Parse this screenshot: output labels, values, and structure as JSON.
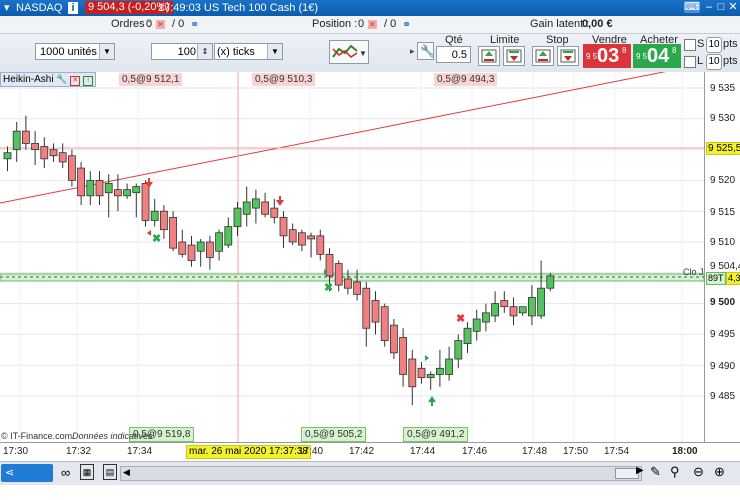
{
  "titlebar": {
    "instrument": "NASDAQ",
    "info_icon": "i",
    "price_change": "9 504,3 (-0,20%)",
    "time_title": "17:49:03 US Tech 100 Cash (1€)"
  },
  "status": {
    "orders_label": "Ordres :",
    "orders_value": "0",
    "orders_sep": "/ 0",
    "position_label": "Position :",
    "position_value": "0",
    "position_sep": "/ 0",
    "gain_label": "Gain latent :",
    "gain_value": "0,00 €"
  },
  "toolbar": {
    "units_value": "1000 unités",
    "ticks_value": "100",
    "ticks_unit": "(x) ticks",
    "qty_label": "Qté",
    "qty_value": "0.5",
    "limit_label": "Limite",
    "stop_label": "Stop",
    "sell_label": "Vendre",
    "buy_label": "Acheter",
    "sell_prefix": "9 5",
    "sell_big": "03",
    "sell_sup": "8",
    "buy_prefix": "9 5",
    "buy_big": "04",
    "buy_sup": "8",
    "s_label": "S",
    "l_label": "L",
    "s_pts_value": "10",
    "l_pts_value": "10",
    "pts_label": "pts"
  },
  "chart": {
    "indicator_label": "Heikin-Ashi",
    "copyright": "© IT-Finance.com",
    "indicators_text": "Données indicatives",
    "close_label": "Clo J",
    "crosshair_date": "mar. 26 mai 2020 17:37:38",
    "tags_top": [
      "0,5@9 512,1",
      "0,5@9 510,3",
      "0,5@9 494,3"
    ],
    "tags_bottom": [
      "0,5@9 519,8",
      "0,5@9 505,2",
      "0,5@9 491,2"
    ],
    "yaxis_labels": [
      "9 535",
      "9 530",
      "9 520",
      "9 515",
      "9 510",
      "9 504,4",
      "9 500",
      "9 495",
      "9 490",
      "9 485"
    ],
    "price_marker": "9 525,5",
    "bt_marker": "89T",
    "bt_value": "4,3",
    "xaxis_labels": [
      "17:30",
      "17:32",
      "17:34",
      "17:40",
      "17:42",
      "17:44",
      "17:46",
      "17:48",
      "17:50",
      "17:54",
      "18:00"
    ]
  },
  "chart_data": {
    "type": "candlestick",
    "ylim": [
      9483,
      9539
    ],
    "candles": [
      {
        "o": 9523.5,
        "h": 9525.5,
        "l": 9521.5,
        "c": 9524.5
      },
      {
        "o": 9525.0,
        "h": 9529.5,
        "l": 9523.0,
        "c": 9528.0
      },
      {
        "o": 9528.0,
        "h": 9530.5,
        "l": 9525.0,
        "c": 9526.0
      },
      {
        "o": 9526.0,
        "h": 9528.0,
        "l": 9522.5,
        "c": 9525.0
      },
      {
        "o": 9525.5,
        "h": 9527.0,
        "l": 9522.0,
        "c": 9523.5
      },
      {
        "o": 9525.0,
        "h": 9526.0,
        "l": 9523.0,
        "c": 9524.0
      },
      {
        "o": 9524.5,
        "h": 9526.0,
        "l": 9522.0,
        "c": 9523.0
      },
      {
        "o": 9524.0,
        "h": 9525.0,
        "l": 9519.0,
        "c": 9520.0
      },
      {
        "o": 9522.0,
        "h": 9523.0,
        "l": 9516.0,
        "c": 9517.5
      },
      {
        "o": 9517.5,
        "h": 9521.5,
        "l": 9516.0,
        "c": 9520.0
      },
      {
        "o": 9520.0,
        "h": 9521.5,
        "l": 9516.0,
        "c": 9517.5
      },
      {
        "o": 9518.0,
        "h": 9521.0,
        "l": 9514.0,
        "c": 9519.5
      },
      {
        "o": 9518.5,
        "h": 9521.0,
        "l": 9515.0,
        "c": 9517.5
      },
      {
        "o": 9517.5,
        "h": 9519.5,
        "l": 9517.0,
        "c": 9518.5
      },
      {
        "o": 9518.0,
        "h": 9519.5,
        "l": 9514.0,
        "c": 9519.0
      },
      {
        "o": 9519.5,
        "h": 9520.0,
        "l": 9512.5,
        "c": 9513.5
      },
      {
        "o": 9513.5,
        "h": 9517.0,
        "l": 9512.5,
        "c": 9515.0
      },
      {
        "o": 9515.0,
        "h": 9516.0,
        "l": 9510.5,
        "c": 9512.0
      },
      {
        "o": 9514.0,
        "h": 9515.0,
        "l": 9508.5,
        "c": 9509.0
      },
      {
        "o": 9510.0,
        "h": 9512.0,
        "l": 9507.5,
        "c": 9508.0
      },
      {
        "o": 9509.5,
        "h": 9511.0,
        "l": 9506.0,
        "c": 9507.0
      },
      {
        "o": 9508.5,
        "h": 9510.5,
        "l": 9506.0,
        "c": 9510.0
      },
      {
        "o": 9510.0,
        "h": 9511.0,
        "l": 9505.5,
        "c": 9507.5
      },
      {
        "o": 9508.5,
        "h": 9512.0,
        "l": 9507.0,
        "c": 9511.5
      },
      {
        "o": 9509.5,
        "h": 9514.0,
        "l": 9509.0,
        "c": 9512.5
      },
      {
        "o": 9512.5,
        "h": 9516.5,
        "l": 9511.0,
        "c": 9515.5
      },
      {
        "o": 9514.5,
        "h": 9519.0,
        "l": 9512.5,
        "c": 9516.5
      },
      {
        "o": 9515.5,
        "h": 9518.5,
        "l": 9513.0,
        "c": 9517.0
      },
      {
        "o": 9516.5,
        "h": 9518.0,
        "l": 9514.0,
        "c": 9514.5
      },
      {
        "o": 9515.5,
        "h": 9517.0,
        "l": 9513.0,
        "c": 9514.0
      },
      {
        "o": 9514.0,
        "h": 9515.0,
        "l": 9509.0,
        "c": 9511.0
      },
      {
        "o": 9512.0,
        "h": 9513.0,
        "l": 9509.5,
        "c": 9510.0
      },
      {
        "o": 9511.5,
        "h": 9512.0,
        "l": 9508.5,
        "c": 9509.5
      },
      {
        "o": 9511.0,
        "h": 9511.5,
        "l": 9507.5,
        "c": 9510.5
      },
      {
        "o": 9511.0,
        "h": 9512.0,
        "l": 9507.0,
        "c": 9508.0
      },
      {
        "o": 9508.0,
        "h": 9509.0,
        "l": 9502.0,
        "c": 9504.5
      },
      {
        "o": 9506.5,
        "h": 9507.0,
        "l": 9502.0,
        "c": 9503.0
      },
      {
        "o": 9504.0,
        "h": 9505.5,
        "l": 9501.5,
        "c": 9502.5
      },
      {
        "o": 9503.5,
        "h": 9505.5,
        "l": 9500.5,
        "c": 9501.5
      },
      {
        "o": 9502.5,
        "h": 9503.5,
        "l": 9493.0,
        "c": 9496.0
      },
      {
        "o": 9500.5,
        "h": 9502.0,
        "l": 9495.0,
        "c": 9497.0
      },
      {
        "o": 9499.5,
        "h": 9500.0,
        "l": 9493.0,
        "c": 9494.0
      },
      {
        "o": 9496.5,
        "h": 9497.5,
        "l": 9491.0,
        "c": 9492.0
      },
      {
        "o": 9494.5,
        "h": 9496.0,
        "l": 9486.5,
        "c": 9488.5
      },
      {
        "o": 9491.0,
        "h": 9492.5,
        "l": 9483.5,
        "c": 9486.5
      },
      {
        "o": 9489.5,
        "h": 9490.5,
        "l": 9487.0,
        "c": 9488.0
      },
      {
        "o": 9488.0,
        "h": 9489.0,
        "l": 9486.0,
        "c": 9488.5
      },
      {
        "o": 9488.5,
        "h": 9492.5,
        "l": 9486.5,
        "c": 9489.5
      },
      {
        "o": 9488.5,
        "h": 9493.0,
        "l": 9487.5,
        "c": 9491.0
      },
      {
        "o": 9491.0,
        "h": 9495.0,
        "l": 9489.5,
        "c": 9494.0
      },
      {
        "o": 9493.5,
        "h": 9497.0,
        "l": 9492.0,
        "c": 9496.0
      },
      {
        "o": 9495.5,
        "h": 9499.0,
        "l": 9494.0,
        "c": 9497.5
      },
      {
        "o": 9497.0,
        "h": 9500.0,
        "l": 9495.5,
        "c": 9498.5
      },
      {
        "o": 9498.0,
        "h": 9502.0,
        "l": 9497.0,
        "c": 9500.0
      },
      {
        "o": 9500.5,
        "h": 9502.0,
        "l": 9498.5,
        "c": 9499.5
      },
      {
        "o": 9499.5,
        "h": 9501.0,
        "l": 9496.5,
        "c": 9498.0
      },
      {
        "o": 9498.5,
        "h": 9499.5,
        "l": 9498.0,
        "c": 9499.5
      },
      {
        "o": 9498.0,
        "h": 9503.0,
        "l": 9496.5,
        "c": 9501.0
      },
      {
        "o": 9498.0,
        "h": 9507.0,
        "l": 9497.5,
        "c": 9502.5
      },
      {
        "o": 9502.5,
        "h": 9505.0,
        "l": 9502.0,
        "c": 9504.5
      }
    ],
    "grid": true
  },
  "colors": {
    "bull": "#55c35d",
    "bear": "#f07f7f",
    "trend": "#e23a3a",
    "sell": "#d9353a",
    "buy": "#2aa84a",
    "marker_yellow": "#f2f22a"
  },
  "bottom": {
    "share_label": "Partager"
  }
}
